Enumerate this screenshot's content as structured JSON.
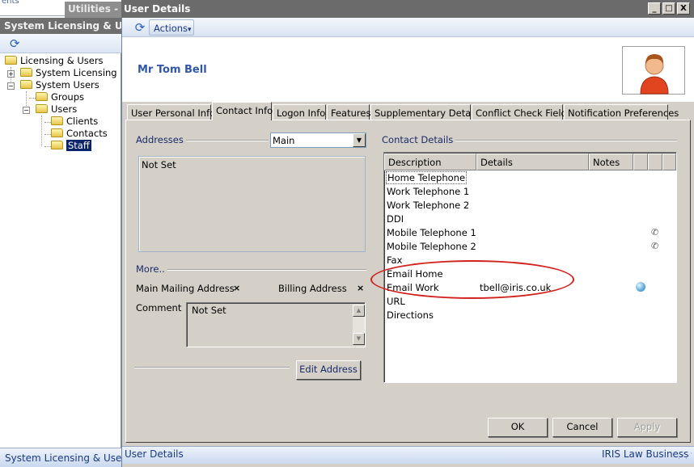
{
  "background_app": {
    "top_fragment": "ents",
    "utilities_title": "Utilities - IF",
    "left_title": "System Licensing & Users",
    "tree": [
      {
        "label": "Licensing & Users"
      },
      {
        "label": "System Licensing"
      },
      {
        "label": "System Users"
      },
      {
        "label": "Groups"
      },
      {
        "label": "Users"
      },
      {
        "label": "Clients"
      },
      {
        "label": "Contacts"
      },
      {
        "label": "Staff",
        "selected": true
      }
    ],
    "status": "System Licensing & Users"
  },
  "window": {
    "title": "User Details",
    "controls": {
      "minimize": "_",
      "maximize": "□",
      "close": "X"
    }
  },
  "toolbar": {
    "refresh_icon": "refresh-icon",
    "actions_label": "Actions",
    "actions_caret": "▾"
  },
  "header": {
    "user_name": "Mr Tom Bell",
    "avatar_icon": "user-avatar-icon"
  },
  "tabs": [
    {
      "label": "User Personal Info"
    },
    {
      "label": "Contact Info",
      "active": true
    },
    {
      "label": "Logon Info"
    },
    {
      "label": "Features"
    },
    {
      "label": "Supplementary Details"
    },
    {
      "label": "Conflict Check Fields"
    },
    {
      "label": "Notification Preferences"
    }
  ],
  "addresses": {
    "group_label": "Addresses",
    "selected_type": "Main",
    "address_text": "Not Set",
    "more_label": "More..",
    "main_mailing_label": "Main Mailing Address",
    "main_mailing_value": "×",
    "billing_label": "Billing Address",
    "billing_value": "×",
    "comment_label": "Comment",
    "comment_value": "Not Set",
    "edit_button": "Edit Address"
  },
  "contact_details": {
    "group_label": "Contact Details",
    "columns": [
      "Description",
      "Details",
      "Notes",
      "",
      ""
    ],
    "rows": [
      {
        "description": "Home Telephone",
        "details": "",
        "icon": ""
      },
      {
        "description": "Work Telephone 1",
        "details": "",
        "icon": ""
      },
      {
        "description": "Work Telephone 2",
        "details": "",
        "icon": ""
      },
      {
        "description": "DDI",
        "details": "",
        "icon": ""
      },
      {
        "description": "Mobile Telephone 1",
        "details": "",
        "icon": "phone-icon"
      },
      {
        "description": "Mobile Telephone 2",
        "details": "",
        "icon": "phone-icon"
      },
      {
        "description": "Fax",
        "details": "",
        "icon": ""
      },
      {
        "description": "Email Home",
        "details": "",
        "icon": ""
      },
      {
        "description": "Email Work",
        "details": "tbell@iris.co.uk",
        "icon": "email-icon"
      },
      {
        "description": "URL",
        "details": "",
        "icon": ""
      },
      {
        "description": "Directions",
        "details": "",
        "icon": ""
      }
    ],
    "highlight_color": "#d2201c"
  },
  "buttons": {
    "ok": "OK",
    "cancel": "Cancel",
    "apply": "Apply"
  },
  "statusbar": {
    "left": "User Details",
    "right": "IRIS Law Business"
  }
}
